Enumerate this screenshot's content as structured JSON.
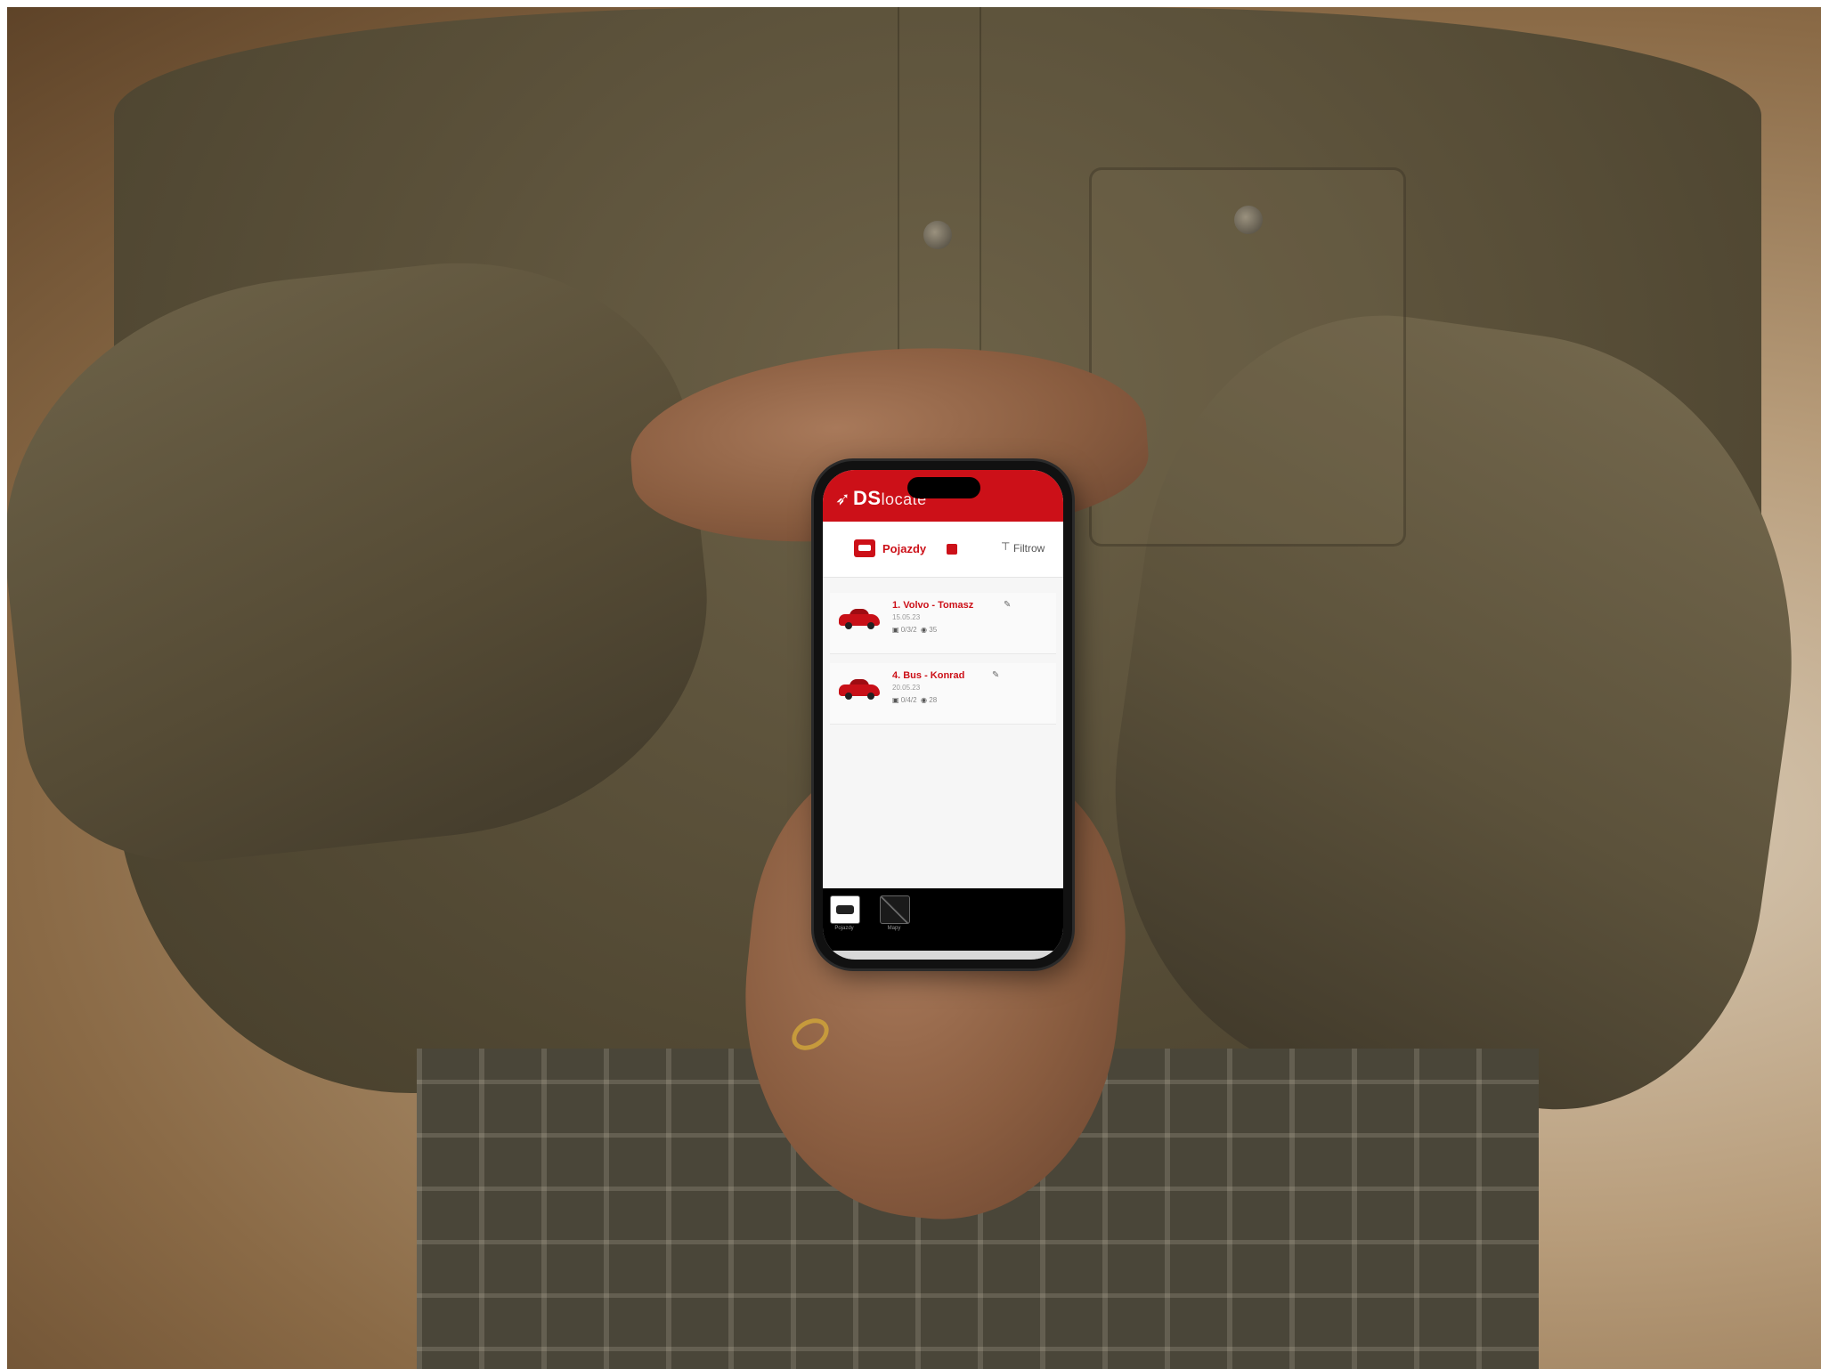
{
  "app": {
    "logo_mark": "➶",
    "logo_bold": "DS",
    "logo_light": "locate"
  },
  "tabs": {
    "active_label": "Pojazdy",
    "filter_label": "Filtrow"
  },
  "vehicles": [
    {
      "name": "1. Volvo - Tomasz",
      "date": "15.05.23",
      "meta_a": "0/3/2",
      "meta_b": "35"
    },
    {
      "name": "4. Bus - Konrad",
      "date": "20.05.23",
      "meta_a": "0/4/2",
      "meta_b": "28"
    }
  ],
  "bottom_nav": {
    "vehicles_label": "Pojazdy",
    "maps_label": "Mapy"
  },
  "colors": {
    "brand_red": "#cc1018",
    "nav_bg": "#000000"
  },
  "icons": {
    "tab": "vehicle-icon",
    "filter": "filter-icon",
    "edit": "pencil-icon",
    "meta_a": "calendar-icon",
    "meta_b": "clock-icon"
  }
}
